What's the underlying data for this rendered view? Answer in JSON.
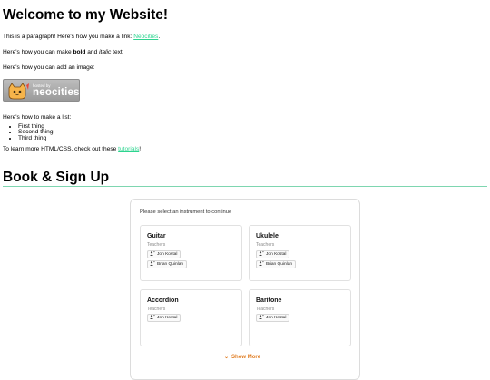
{
  "heading": "Welcome to my Website!",
  "intro": {
    "before": "This is a paragraph! Here's how you make a link: ",
    "link": "Neocities",
    "after": "."
  },
  "format_line": {
    "before": "Here's how you can make ",
    "bold": "bold",
    "middle": " and ",
    "italic": "italic",
    "after": " text."
  },
  "image_line": "Here's how you can add an image:",
  "badge": {
    "small_text": "hosted by",
    "big_text": "neocities"
  },
  "list_line": "Here's how to make a list:",
  "list_items": [
    "First thing",
    "Second thing",
    "Third thing"
  ],
  "learn": {
    "before": "To learn more HTML/CSS, check out these ",
    "link": "tutorials",
    "after": "!"
  },
  "booking": {
    "heading": "Book & Sign Up",
    "prompt": "Please select an instrument to continue",
    "instruments": [
      {
        "name": "Guitar",
        "sub": "Teachers",
        "teachers": [
          "Jon Kostal",
          "Brian Quinlan"
        ]
      },
      {
        "name": "Ukulele",
        "sub": "Teachers",
        "teachers": [
          "Jon Kostal",
          "Brian Quinlan"
        ]
      },
      {
        "name": "Accordion",
        "sub": "Teachers",
        "teachers": [
          "Jon Kostal"
        ]
      },
      {
        "name": "Baritone",
        "sub": "Teachers",
        "teachers": [
          "Jon Kostal"
        ]
      }
    ],
    "show_more": "Show More"
  },
  "colors": {
    "link": "#2dd48f",
    "rule": "#7ed6b0",
    "accent": "#e07b1f"
  }
}
